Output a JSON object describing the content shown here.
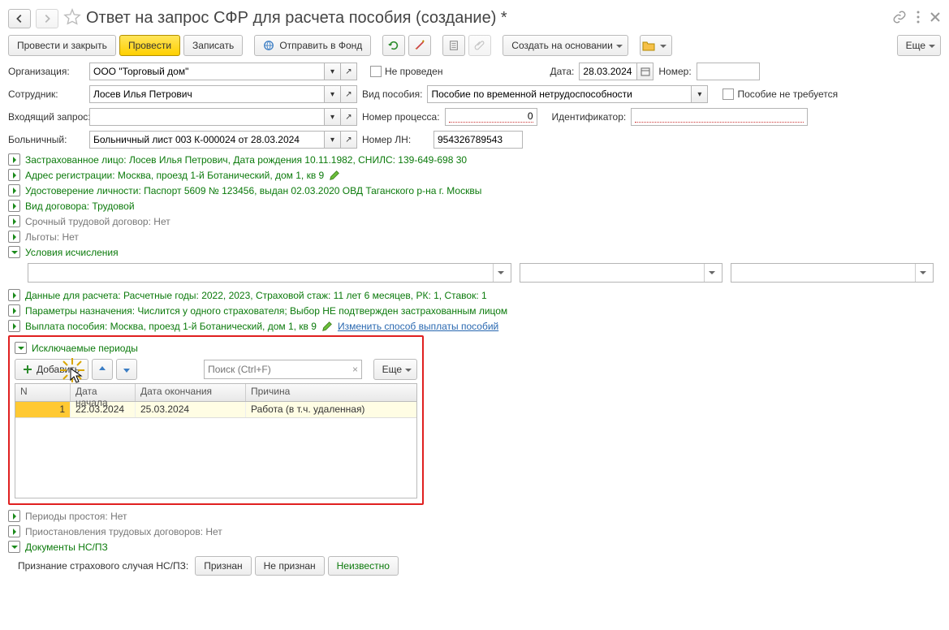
{
  "header": {
    "title": "Ответ на запрос СФР для расчета пособия (создание) *"
  },
  "toolbar": {
    "post_and_close": "Провести и закрыть",
    "post": "Провести",
    "write": "Записать",
    "send_to_fund": "Отправить в Фонд",
    "create_based_on": "Создать на основании",
    "more": "Еще"
  },
  "fields": {
    "org_label": "Организация:",
    "org_value": "ООО \"Торговый дом\"",
    "not_posted": "Не проведен",
    "date_label": "Дата:",
    "date_value": "28.03.2024",
    "number_label": "Номер:",
    "number_value": "",
    "employee_label": "Сотрудник:",
    "employee_value": "Лосев Илья Петрович",
    "benefit_type_label": "Вид пособия:",
    "benefit_type_value": "Пособие по временной нетрудоспособности",
    "benefit_not_required": "Пособие не требуется",
    "incoming_request_label": "Входящий запрос:",
    "incoming_request_value": "",
    "process_no_label": "Номер процесса:",
    "process_no_value": "0",
    "identifier_label": "Идентификатор:",
    "identifier_value": "",
    "sickleave_label": "Больничный:",
    "sickleave_value": "Больничный лист 003 К-000024 от 28.03.2024",
    "ln_no_label": "Номер ЛН:",
    "ln_no_value": "954326789543"
  },
  "sections": {
    "insured": "Застрахованное лицо: Лосев Илья Петрович, Дата рождения 10.11.1982, СНИЛС: 139-649-698 30",
    "address": "Адрес регистрации: Москва, проезд 1-й Ботанический, дом 1, кв 9",
    "id_doc": "Удостоверение личности: Паспорт 5609 № 123456, выдан 02.03.2020 ОВД Таганского р-на г. Москвы",
    "contract": "Вид договора: Трудовой",
    "fixed_term": "Срочный трудовой договор: Нет",
    "benefits": "Льготы: Нет",
    "calc_conditions": "Условия исчисления",
    "calc_data": "Данные для расчета: Расчетные годы: 2022, 2023, Страховой стаж: 11 лет 6 месяцев, РК: 1, Ставок: 1",
    "assignment": "Параметры назначения: Числится у одного страхователя; Выбор НЕ подтвержден застрахованным лицом",
    "payout": "Выплата пособия: Москва, проезд 1-й Ботанический, дом 1, кв 9",
    "change_payout_link": "Изменить способ выплаты пособий",
    "excluded_periods": "Исключаемые периоды",
    "idle_periods": "Периоды простоя: Нет",
    "suspensions": "Приостановления трудовых договоров: Нет",
    "nspz_docs": "Документы НС/ПЗ",
    "nspz_label": "Признание страхового случая НС/ПЗ:",
    "recognized": "Признан",
    "not_recognized": "Не признан",
    "unknown": "Неизвестно"
  },
  "periods_table": {
    "add_btn": "Добавить",
    "search_placeholder": "Поиск (Ctrl+F)",
    "more": "Еще",
    "cols": {
      "n": "N",
      "start": "Дата начала",
      "end": "Дата окончания",
      "reason": "Причина"
    },
    "rows": [
      {
        "n": "1",
        "start": "22.03.2024",
        "end": "25.03.2024",
        "reason": "Работа (в т.ч. удаленная)"
      }
    ]
  }
}
